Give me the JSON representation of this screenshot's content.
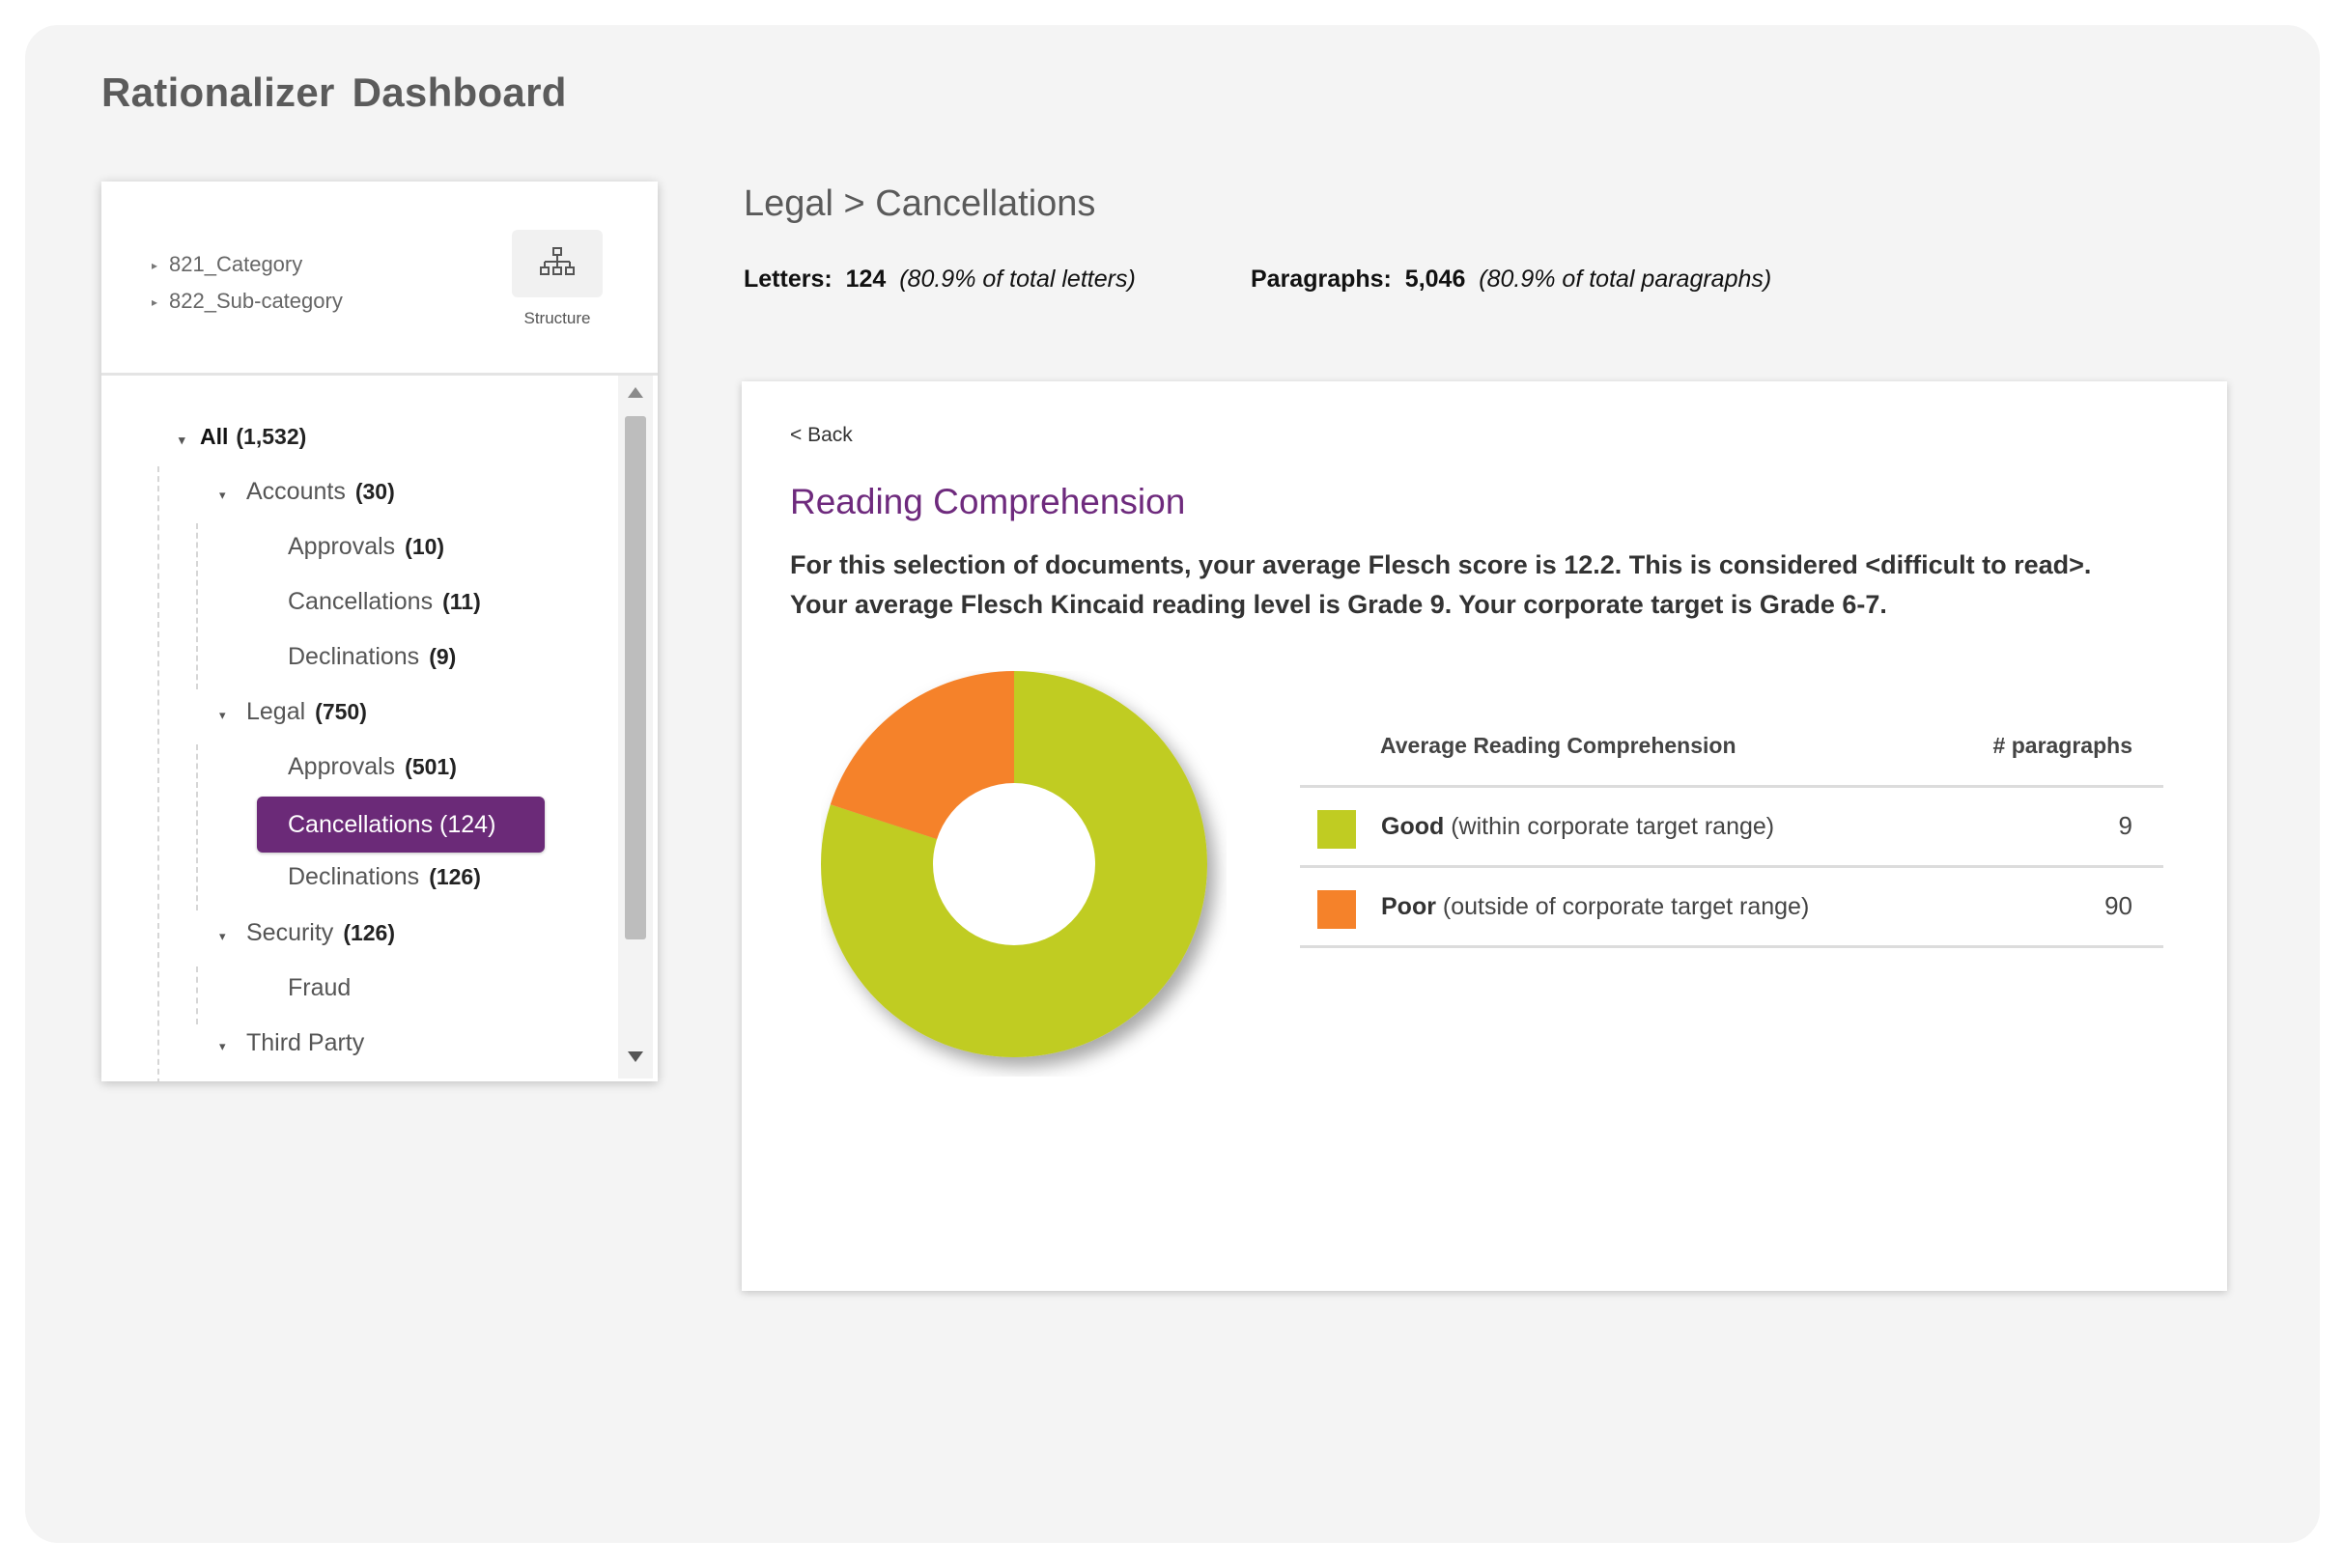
{
  "app": {
    "title": "Rationalizer  Dashboard"
  },
  "structure_panel": {
    "categories": [
      "821_Category",
      "822_Sub-category"
    ],
    "structure_label": "Structure"
  },
  "tree": {
    "root": {
      "label": "All",
      "count": "(1,532)"
    },
    "accounts": {
      "label": "Accounts",
      "count": "(30)"
    },
    "accounts_approvals": {
      "label": "Approvals",
      "count": "(10)"
    },
    "accounts_cancellations": {
      "label": "Cancellations",
      "count": "(11)"
    },
    "accounts_declinations": {
      "label": "Declinations",
      "count": "(9)"
    },
    "legal": {
      "label": "Legal",
      "count": "(750)"
    },
    "legal_approvals": {
      "label": "Approvals",
      "count": "(501)"
    },
    "legal_cancellations": {
      "label": "Cancellations (124)"
    },
    "legal_declinations": {
      "label": "Declinations",
      "count": "(126)"
    },
    "security": {
      "label": "Security",
      "count": "(126)"
    },
    "security_fraud": {
      "label": "Fraud"
    },
    "third_party": {
      "label": "Third Party"
    }
  },
  "header": {
    "breadcrumb": "Legal > Cancellations",
    "letters_label": "Letters:",
    "letters_value": "124",
    "letters_pct": "(80.9% of total letters)",
    "paragraphs_label": "Paragraphs:",
    "paragraphs_value": "5,046",
    "paragraphs_pct": "(80.9% of total paragraphs)"
  },
  "card": {
    "back": "< Back",
    "title": "Reading Comprehension",
    "desc_line1": "For this selection of documents, your average Flesch score is 12.2. This is considered <difficult to read>.",
    "desc_line2": "Your average Flesch Kincaid reading level is Grade 9. Your corporate target is Grade 6-7."
  },
  "legend": {
    "col1": "Average Reading Comprehension",
    "col2": "# paragraphs",
    "rows": [
      {
        "name": "Good",
        "desc": "(within corporate target range)",
        "value": "9"
      },
      {
        "name": "Poor",
        "desc": "(outside of corporate target range)",
        "value": "90"
      }
    ]
  },
  "colors": {
    "good": "#c0cc22",
    "poor": "#f5822a",
    "accent": "#6b2a78"
  },
  "chart_data": {
    "type": "pie",
    "categories": [
      "Good",
      "Poor"
    ],
    "values": [
      80,
      20
    ],
    "colors": [
      "#c0cc22",
      "#f5822a"
    ],
    "title": "",
    "donut": true
  }
}
